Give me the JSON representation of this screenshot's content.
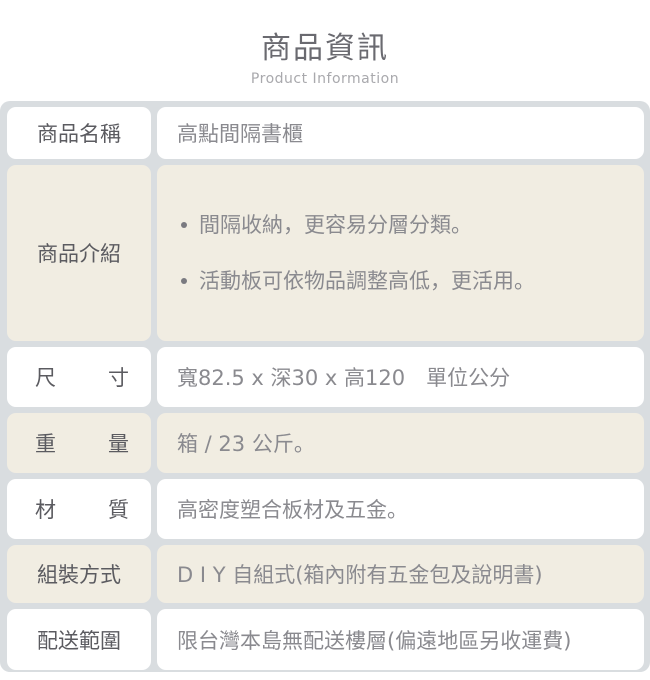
{
  "header": {
    "title": "商品資訊",
    "subtitle": "Product Information"
  },
  "colors": {
    "frame": "#d9dde0",
    "cell_white": "#ffffff",
    "cell_beige": "#f1ede2",
    "label_text": "#5b5b60",
    "value_text": "#8a8a8f"
  },
  "rows": [
    {
      "label": "商品名稱",
      "value": "高點間隔書櫃"
    },
    {
      "label": "商品介紹",
      "bullets": [
        "間隔收納，更容易分層分類。",
        "活動板可依物品調整高低，更活用。"
      ]
    },
    {
      "label_chars": [
        "尺",
        "寸"
      ],
      "value": "寬82.5 x 深30 x 高120　單位公分"
    },
    {
      "label_chars": [
        "重",
        "量"
      ],
      "value": "箱 / 23 公斤。"
    },
    {
      "label_chars": [
        "材",
        "質"
      ],
      "value": "高密度塑合板材及五金。"
    },
    {
      "label": "組裝方式",
      "value": "D I Y 自組式(箱內附有五金包及說明書)"
    },
    {
      "label": "配送範圍",
      "value": "限台灣本島無配送樓層(偏遠地區另收運費)"
    }
  ]
}
